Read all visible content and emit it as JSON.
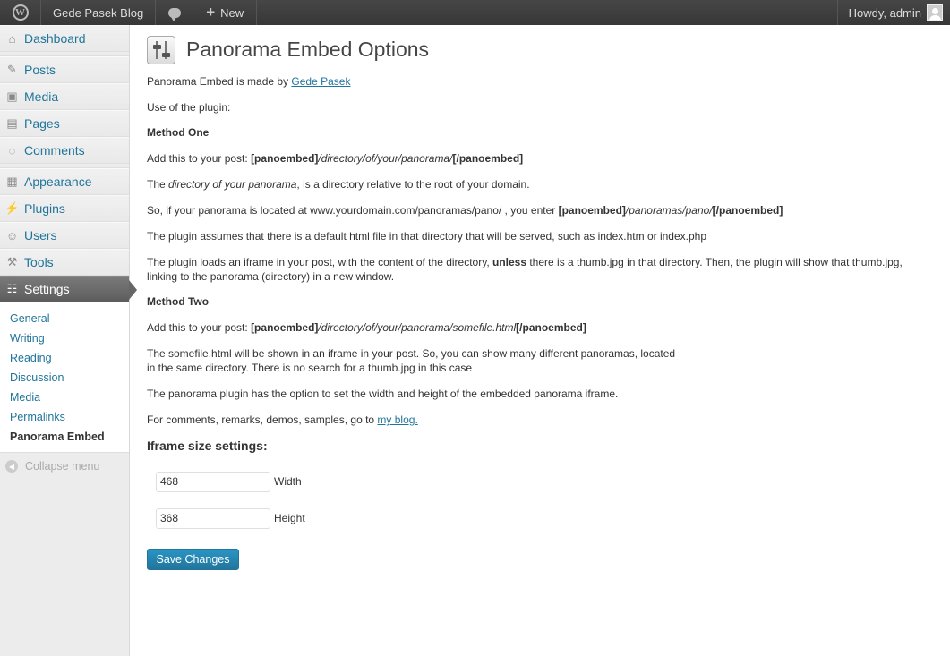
{
  "adminbar": {
    "site_name": "Gede Pasek Blog",
    "new_label": "New",
    "howdy": "Howdy, admin"
  },
  "sidebar": {
    "items": [
      {
        "label": "Dashboard",
        "icon": "dashboard-icon"
      },
      {
        "label": "Posts",
        "icon": "pin-icon"
      },
      {
        "label": "Media",
        "icon": "media-icon"
      },
      {
        "label": "Pages",
        "icon": "pages-icon"
      },
      {
        "label": "Comments",
        "icon": "comment-icon"
      },
      {
        "label": "Appearance",
        "icon": "appearance-icon"
      },
      {
        "label": "Plugins",
        "icon": "plugin-icon"
      },
      {
        "label": "Users",
        "icon": "users-icon"
      },
      {
        "label": "Tools",
        "icon": "tools-icon"
      },
      {
        "label": "Settings",
        "icon": "settings-icon"
      }
    ],
    "submenu": [
      "General",
      "Writing",
      "Reading",
      "Discussion",
      "Media",
      "Permalinks",
      "Panorama Embed"
    ],
    "collapse": "Collapse menu"
  },
  "page": {
    "title": "Panorama Embed Options",
    "made_by_prefix": "Panorama Embed is made by ",
    "made_by_link": "Gede Pasek",
    "use_of_plugin": "Use of the plugin:",
    "method_one": "Method One",
    "m1_add": "Add this to your post: ",
    "shortcode_open": "[panoembed]",
    "shortcode_close": "[/panoembed]",
    "m1_path": "/directory/of/your/panorama/",
    "dir_prefix": "The ",
    "dir_em": "directory of your panorama",
    "dir_suffix": ", is a directory relative to the root of your domain.",
    "so_prefix": "So, if your panorama is located at www.yourdomain.com/panoramas/pano/ , you enter ",
    "so_path": "/panoramas/pano/",
    "assumes": "The plugin assumes that there is a default html file in that directory that will be served, such as index.htm or index.php",
    "loads_prefix": "The plugin loads an iframe in your post, with the content of the directory, ",
    "loads_unless": "unless",
    "loads_suffix": " there is a thumb.jpg in that directory. Then, the plugin will show that thumb.jpg, linking to the panorama (directory) in a new window.",
    "method_two": "Method Two",
    "m2_add": "Add this to your post: ",
    "m2_path": "/directory/of/your/panorama/somefile.html",
    "somefile_line1": "The somefile.html will be shown in an iframe in your post. So, you can show many different panoramas, located",
    "somefile_line2": "in the same directory. There is no search for a thumb.jpg in this case",
    "option_text": "The panorama plugin has the option to set the width and height of the embedded panorama iframe.",
    "comments_prefix": "For comments, remarks, demos, samples, go to ",
    "comments_link": "my blog.",
    "settings_heading": "Iframe size settings:",
    "width_value": "468",
    "width_label": "Width",
    "height_value": "368",
    "height_label": "Height",
    "save_button": "Save Changes"
  }
}
